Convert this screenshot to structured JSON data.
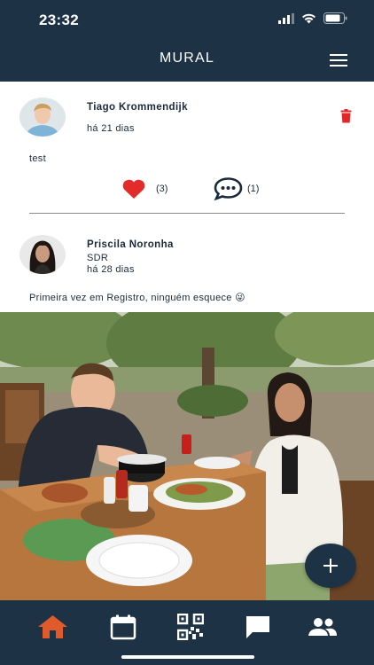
{
  "status_bar": {
    "time": "23:32"
  },
  "header": {
    "title": "MURAL"
  },
  "posts": [
    {
      "author": "Tiago Krommendijk",
      "time_ago": "há 21 dias",
      "text": "test",
      "likes": "(3)",
      "comments": "(1)"
    },
    {
      "author": "Priscila Noronha",
      "role": "SDR",
      "time_ago": "há 28 dias",
      "text": "Primeira vez em Registro, ninguém esquece 😜"
    }
  ],
  "fab": {
    "icon": "plus-icon"
  },
  "tabs": [
    {
      "icon": "home-icon",
      "active": true
    },
    {
      "icon": "calendar-icon",
      "active": false
    },
    {
      "icon": "qr-code-icon",
      "active": false
    },
    {
      "icon": "chat-icon",
      "active": false
    },
    {
      "icon": "people-icon",
      "active": false
    }
  ],
  "colors": {
    "navy": "#1e3245",
    "accent_orange": "#e05a2b",
    "like_red": "#e32b2b"
  }
}
